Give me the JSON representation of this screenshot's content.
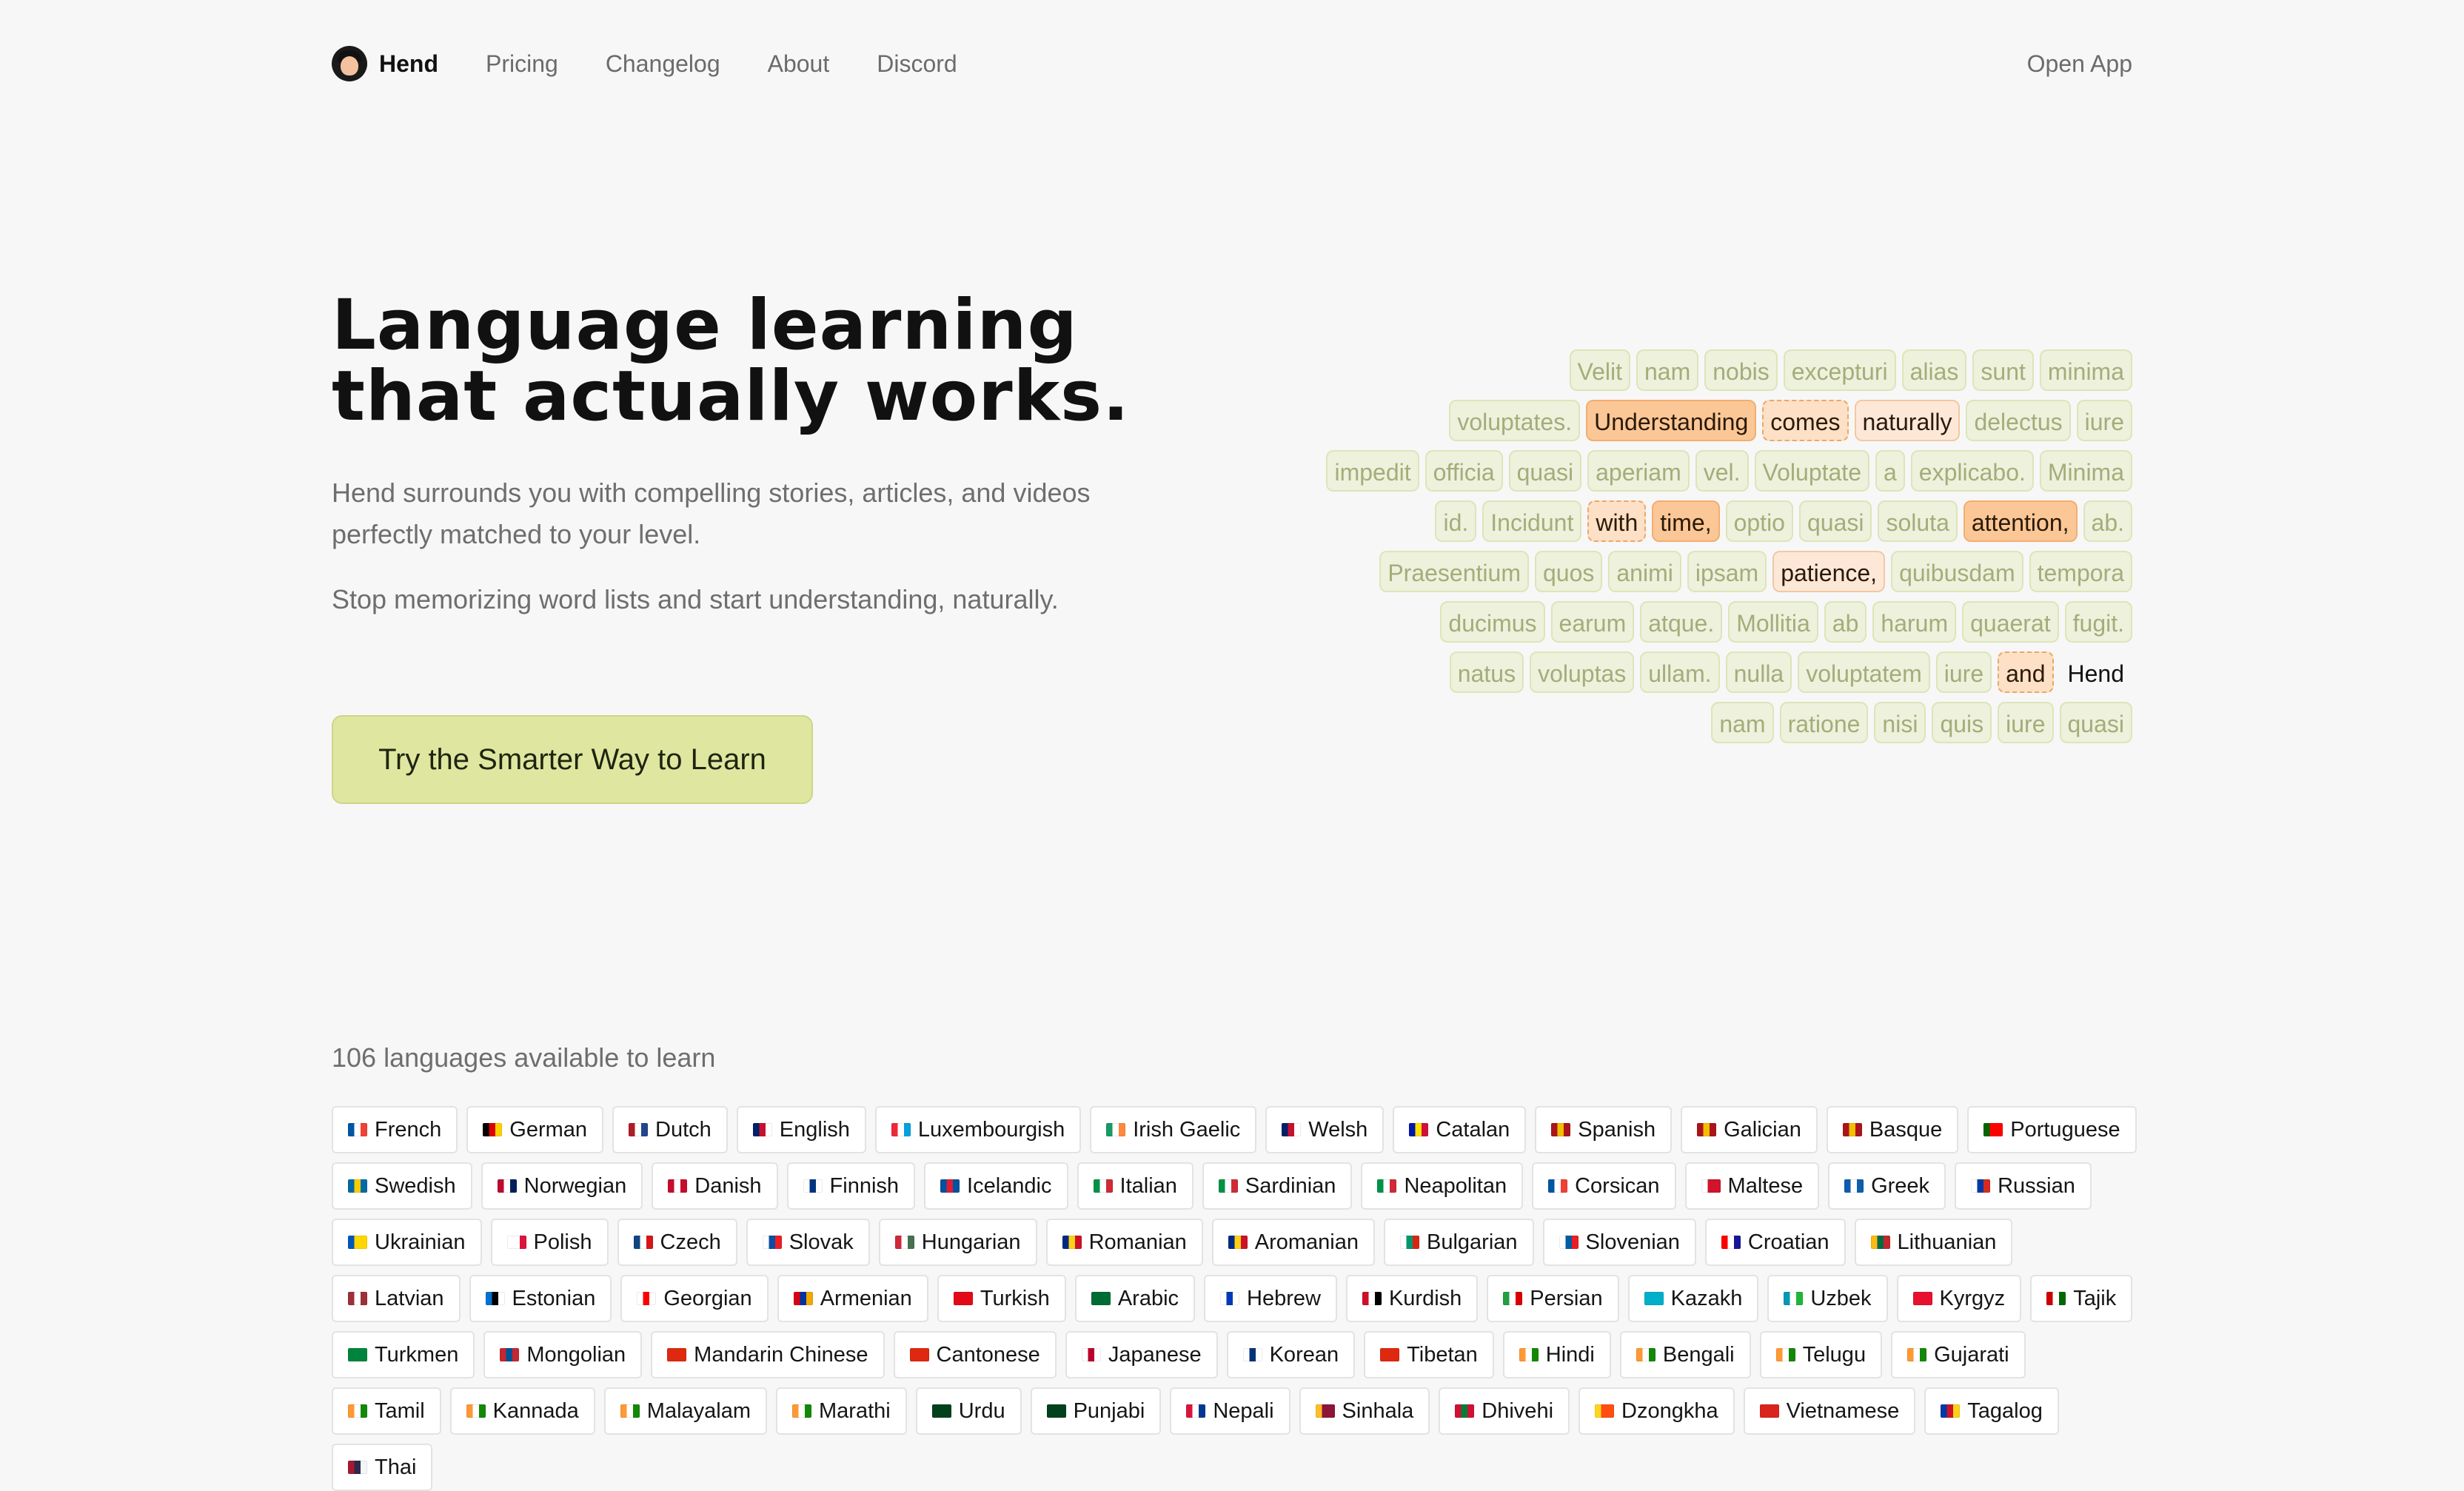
{
  "nav": {
    "brand": "Hend",
    "links": [
      "Pricing",
      "Changelog",
      "About",
      "Discord"
    ],
    "open_app": "Open App"
  },
  "hero": {
    "title_line1": "Language learning",
    "title_line2": "that actually works.",
    "paragraph1": "Hend surrounds you with compelling stories, articles, and videos perfectly matched to your level.",
    "paragraph2": "Stop memorizing word lists and start understanding, naturally.",
    "cta": "Try the Smarter Way to Learn"
  },
  "word_cloud": [
    [
      {
        "t": "Velit"
      },
      {
        "t": "nam"
      },
      {
        "t": "nobis"
      },
      {
        "t": "excepturi"
      },
      {
        "t": "alias"
      },
      {
        "t": "sunt"
      },
      {
        "t": "minima"
      }
    ],
    [
      {
        "t": "voluptates."
      },
      {
        "t": "Understanding",
        "s": "hot"
      },
      {
        "t": "comes",
        "s": "dash"
      },
      {
        "t": "naturally",
        "s": "warm"
      },
      {
        "t": "delectus"
      },
      {
        "t": "iure"
      }
    ],
    [
      {
        "t": "impedit"
      },
      {
        "t": "officia"
      },
      {
        "t": "quasi"
      },
      {
        "t": "aperiam"
      },
      {
        "t": "vel."
      },
      {
        "t": "Voluptate"
      },
      {
        "t": "a"
      },
      {
        "t": "explicabo."
      },
      {
        "t": "Minima"
      }
    ],
    [
      {
        "t": "id."
      },
      {
        "t": "Incidunt"
      },
      {
        "t": "with",
        "s": "dash"
      },
      {
        "t": "time,",
        "s": "hot"
      },
      {
        "t": "optio"
      },
      {
        "t": "quasi"
      },
      {
        "t": "soluta"
      },
      {
        "t": "attention,",
        "s": "hot"
      },
      {
        "t": "ab."
      }
    ],
    [
      {
        "t": "Praesentium"
      },
      {
        "t": "quos"
      },
      {
        "t": "animi"
      },
      {
        "t": "ipsam"
      },
      {
        "t": "patience,",
        "s": "warm"
      },
      {
        "t": "quibusdam"
      },
      {
        "t": "tempora"
      }
    ],
    [
      {
        "t": "ducimus"
      },
      {
        "t": "earum"
      },
      {
        "t": "atque."
      },
      {
        "t": "Mollitia"
      },
      {
        "t": "ab"
      },
      {
        "t": "harum"
      },
      {
        "t": "quaerat"
      },
      {
        "t": "fugit."
      }
    ],
    [
      {
        "t": "natus"
      },
      {
        "t": "voluptas"
      },
      {
        "t": "ullam."
      },
      {
        "t": "nulla"
      },
      {
        "t": "voluptatem"
      },
      {
        "t": "iure"
      },
      {
        "t": "and",
        "s": "dash"
      },
      {
        "t": "Hend",
        "s": "plain"
      }
    ],
    [
      {
        "t": "nam"
      },
      {
        "t": "ratione"
      },
      {
        "t": "nisi"
      },
      {
        "t": "quis"
      },
      {
        "t": "iure"
      },
      {
        "t": "quasi"
      }
    ]
  ],
  "languages_heading": "106 languages available to learn",
  "languages": [
    {
      "name": "French",
      "c": [
        "#0055a4",
        "#ffffff",
        "#ef4135"
      ]
    },
    {
      "name": "German",
      "c": [
        "#000000",
        "#dd0000",
        "#ffce00"
      ]
    },
    {
      "name": "Dutch",
      "c": [
        "#ae1c28",
        "#ffffff",
        "#21468b"
      ]
    },
    {
      "name": "English",
      "c": [
        "#012169",
        "#c8102e",
        "#ffffff"
      ]
    },
    {
      "name": "Luxembourgish",
      "c": [
        "#ed2939",
        "#ffffff",
        "#00a1de"
      ]
    },
    {
      "name": "Irish Gaelic",
      "c": [
        "#169b62",
        "#ffffff",
        "#ff883e"
      ]
    },
    {
      "name": "Welsh",
      "c": [
        "#012169",
        "#c8102e",
        "#ffffff"
      ]
    },
    {
      "name": "Catalan",
      "c": [
        "#0018a8",
        "#fedf00",
        "#d0103a"
      ]
    },
    {
      "name": "Spanish",
      "c": [
        "#aa151b",
        "#f1bf00",
        "#aa151b"
      ]
    },
    {
      "name": "Galician",
      "c": [
        "#aa151b",
        "#f1bf00",
        "#aa151b"
      ]
    },
    {
      "name": "Basque",
      "c": [
        "#aa151b",
        "#f1bf00",
        "#aa151b"
      ]
    },
    {
      "name": "Portuguese",
      "c": [
        "#006600",
        "#ff0000",
        "#ff0000"
      ]
    },
    {
      "name": "Swedish",
      "c": [
        "#006aa7",
        "#fecc00",
        "#006aa7"
      ]
    },
    {
      "name": "Norwegian",
      "c": [
        "#ba0c2f",
        "#ffffff",
        "#00205b"
      ]
    },
    {
      "name": "Danish",
      "c": [
        "#c60c30",
        "#ffffff",
        "#c60c30"
      ]
    },
    {
      "name": "Finnish",
      "c": [
        "#ffffff",
        "#003580",
        "#ffffff"
      ]
    },
    {
      "name": "Icelandic",
      "c": [
        "#02529c",
        "#dc1e35",
        "#02529c"
      ]
    },
    {
      "name": "Italian",
      "c": [
        "#009246",
        "#ffffff",
        "#ce2b37"
      ]
    },
    {
      "name": "Sardinian",
      "c": [
        "#009246",
        "#ffffff",
        "#ce2b37"
      ]
    },
    {
      "name": "Neapolitan",
      "c": [
        "#009246",
        "#ffffff",
        "#ce2b37"
      ]
    },
    {
      "name": "Corsican",
      "c": [
        "#0055a4",
        "#ffffff",
        "#ef4135"
      ]
    },
    {
      "name": "Maltese",
      "c": [
        "#ffffff",
        "#cf142b",
        "#cf142b"
      ]
    },
    {
      "name": "Greek",
      "c": [
        "#0d5eaf",
        "#ffffff",
        "#0d5eaf"
      ]
    },
    {
      "name": "Russian",
      "c": [
        "#ffffff",
        "#0039a6",
        "#d52b1e"
      ]
    },
    {
      "name": "Ukrainian",
      "c": [
        "#0057b7",
        "#ffd700",
        "#ffd700"
      ]
    },
    {
      "name": "Polish",
      "c": [
        "#ffffff",
        "#ffffff",
        "#dc143c"
      ]
    },
    {
      "name": "Czech",
      "c": [
        "#11457e",
        "#ffffff",
        "#d7141a"
      ]
    },
    {
      "name": "Slovak",
      "c": [
        "#ffffff",
        "#0b4ea2",
        "#ee1c25"
      ]
    },
    {
      "name": "Hungarian",
      "c": [
        "#ce2939",
        "#ffffff",
        "#477050"
      ]
    },
    {
      "name": "Romanian",
      "c": [
        "#002b7f",
        "#fcd116",
        "#ce1126"
      ]
    },
    {
      "name": "Aromanian",
      "c": [
        "#002b7f",
        "#fcd116",
        "#ce1126"
      ]
    },
    {
      "name": "Bulgarian",
      "c": [
        "#ffffff",
        "#00966e",
        "#d62612"
      ]
    },
    {
      "name": "Slovenian",
      "c": [
        "#ffffff",
        "#005da4",
        "#ed1c24"
      ]
    },
    {
      "name": "Croatian",
      "c": [
        "#ff0000",
        "#ffffff",
        "#171796"
      ]
    },
    {
      "name": "Lithuanian",
      "c": [
        "#fdb913",
        "#006a44",
        "#c1272d"
      ]
    },
    {
      "name": "Latvian",
      "c": [
        "#9e3039",
        "#ffffff",
        "#9e3039"
      ]
    },
    {
      "name": "Estonian",
      "c": [
        "#0072ce",
        "#000000",
        "#ffffff"
      ]
    },
    {
      "name": "Georgian",
      "c": [
        "#ffffff",
        "#ff0000",
        "#ffffff"
      ]
    },
    {
      "name": "Armenian",
      "c": [
        "#d90012",
        "#0033a0",
        "#f2a800"
      ]
    },
    {
      "name": "Turkish",
      "c": [
        "#e30a17",
        "#e30a17",
        "#e30a17"
      ]
    },
    {
      "name": "Arabic",
      "c": [
        "#006c35",
        "#006c35",
        "#006c35"
      ]
    },
    {
      "name": "Hebrew",
      "c": [
        "#ffffff",
        "#0038b8",
        "#ffffff"
      ]
    },
    {
      "name": "Kurdish",
      "c": [
        "#ce1126",
        "#ffffff",
        "#000000"
      ]
    },
    {
      "name": "Persian",
      "c": [
        "#239f40",
        "#ffffff",
        "#da0000"
      ]
    },
    {
      "name": "Kazakh",
      "c": [
        "#00afca",
        "#00afca",
        "#00afca"
      ]
    },
    {
      "name": "Uzbek",
      "c": [
        "#0099b5",
        "#ffffff",
        "#1eb53a"
      ]
    },
    {
      "name": "Kyrgyz",
      "c": [
        "#e8112d",
        "#e8112d",
        "#e8112d"
      ]
    },
    {
      "name": "Tajik",
      "c": [
        "#cc0000",
        "#ffffff",
        "#006600"
      ]
    },
    {
      "name": "Turkmen",
      "c": [
        "#00843d",
        "#00843d",
        "#00843d"
      ]
    },
    {
      "name": "Mongolian",
      "c": [
        "#c4272f",
        "#015197",
        "#c4272f"
      ]
    },
    {
      "name": "Mandarin Chinese",
      "c": [
        "#de2910",
        "#de2910",
        "#de2910"
      ]
    },
    {
      "name": "Cantonese",
      "c": [
        "#de2910",
        "#de2910",
        "#de2910"
      ]
    },
    {
      "name": "Japanese",
      "c": [
        "#ffffff",
        "#bc002d",
        "#ffffff"
      ]
    },
    {
      "name": "Korean",
      "c": [
        "#ffffff",
        "#003478",
        "#ffffff"
      ]
    },
    {
      "name": "Tibetan",
      "c": [
        "#de2910",
        "#de2910",
        "#de2910"
      ]
    },
    {
      "name": "Hindi",
      "c": [
        "#ff9933",
        "#ffffff",
        "#138808"
      ]
    },
    {
      "name": "Bengali",
      "c": [
        "#ff9933",
        "#ffffff",
        "#138808"
      ]
    },
    {
      "name": "Telugu",
      "c": [
        "#ff9933",
        "#ffffff",
        "#138808"
      ]
    },
    {
      "name": "Gujarati",
      "c": [
        "#ff9933",
        "#ffffff",
        "#138808"
      ]
    },
    {
      "name": "Tamil",
      "c": [
        "#ff9933",
        "#ffffff",
        "#138808"
      ]
    },
    {
      "name": "Kannada",
      "c": [
        "#ff9933",
        "#ffffff",
        "#138808"
      ]
    },
    {
      "name": "Malayalam",
      "c": [
        "#ff9933",
        "#ffffff",
        "#138808"
      ]
    },
    {
      "name": "Marathi",
      "c": [
        "#ff9933",
        "#ffffff",
        "#138808"
      ]
    },
    {
      "name": "Urdu",
      "c": [
        "#01411c",
        "#01411c",
        "#01411c"
      ]
    },
    {
      "name": "Punjabi",
      "c": [
        "#01411c",
        "#01411c",
        "#01411c"
      ]
    },
    {
      "name": "Nepali",
      "c": [
        "#dc143c",
        "#ffffff",
        "#003893"
      ]
    },
    {
      "name": "Sinhala",
      "c": [
        "#ffbe29",
        "#8d153a",
        "#8d153a"
      ]
    },
    {
      "name": "Dhivehi",
      "c": [
        "#d21034",
        "#007e3a",
        "#d21034"
      ]
    },
    {
      "name": "Dzongkha",
      "c": [
        "#ffd520",
        "#ff4e12",
        "#ff4e12"
      ]
    },
    {
      "name": "Vietnamese",
      "c": [
        "#da251d",
        "#da251d",
        "#da251d"
      ]
    },
    {
      "name": "Tagalog",
      "c": [
        "#0038a8",
        "#ce1126",
        "#fcd116"
      ]
    },
    {
      "name": "Thai",
      "c": [
        "#a51931",
        "#2d2a4a",
        "#f4f5f8"
      ]
    }
  ]
}
